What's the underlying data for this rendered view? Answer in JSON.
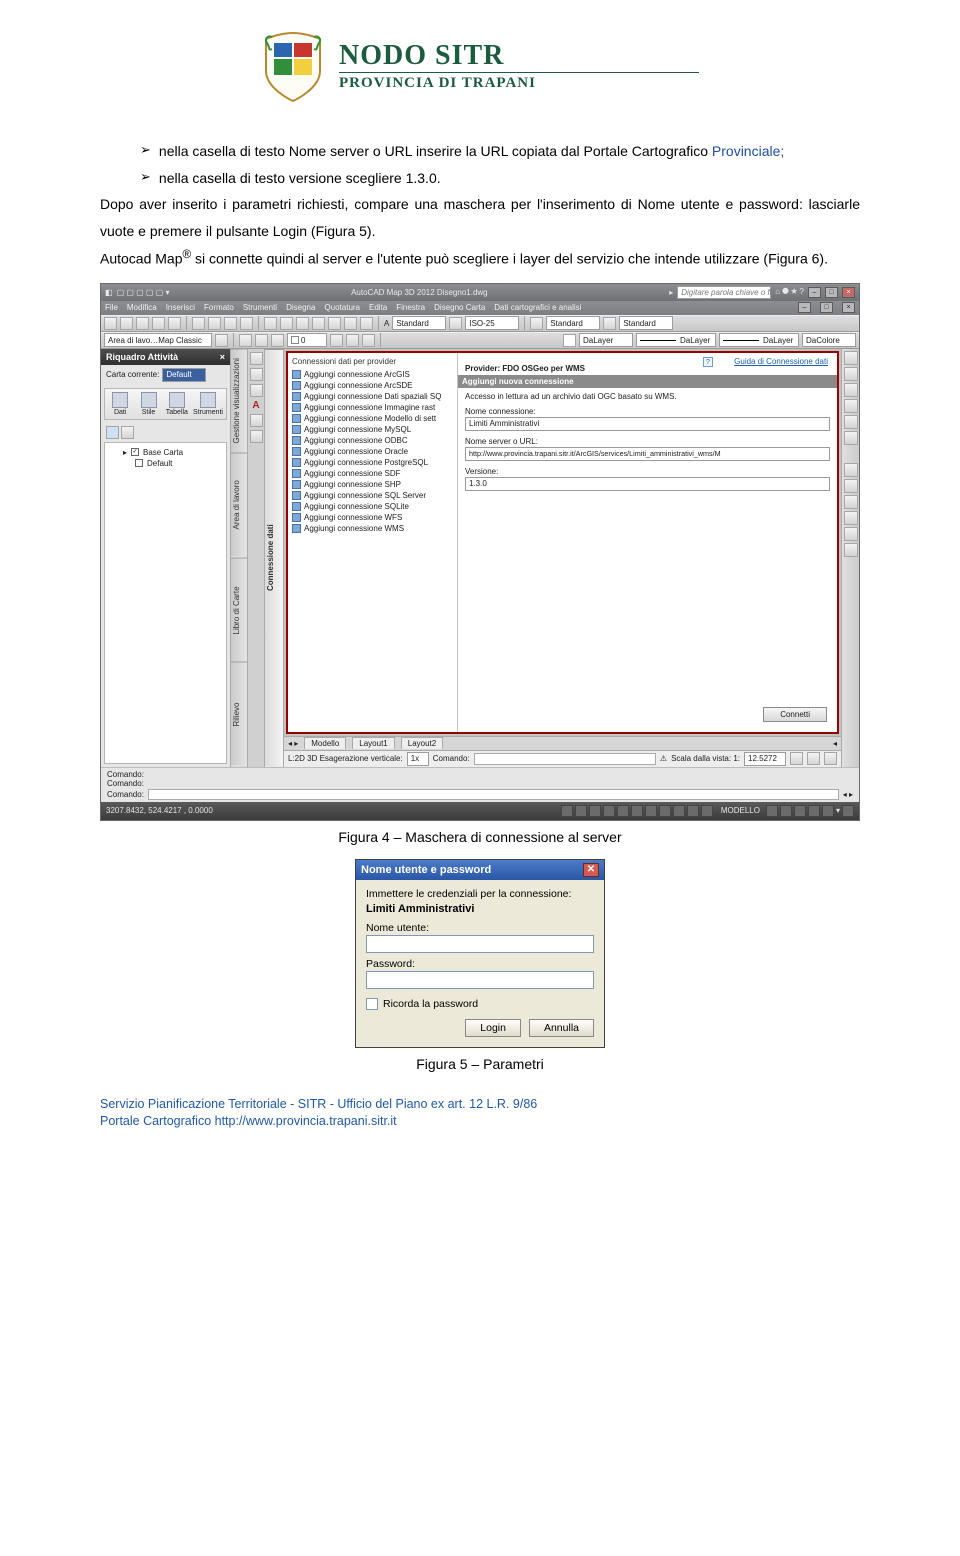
{
  "header": {
    "logo_main": "NODO SITR",
    "logo_sub": "PROVINCIA DI TRAPANI"
  },
  "body": {
    "bullet1_a": "nella casella di testo Nome server o URL inserire la URL copiata dal Portale Cartografico ",
    "bullet1_b": "Provinciale;",
    "bullet2": "nella casella di testo versione scegliere 1.3.0.",
    "para1": "Dopo aver inserito i parametri richiesti, compare una maschera per l'inserimento di Nome utente e password: lasciarle vuote e premere il pulsante Login (Figura 5).",
    "para2_a": "Autocad Map",
    "para2_sup": "®",
    "para2_b": " si connette quindi al server e l'utente può scegliere i layer del servizio che intende utilizzare (Figura 6)."
  },
  "screenshot": {
    "titlebar_title": "AutoCAD Map 3D 2012   Disegno1.dwg",
    "search_placeholder": "Digitare parola chiave o frase",
    "menus": [
      "File",
      "Modifica",
      "Inserisci",
      "Formato",
      "Strumenti",
      "Disegna",
      "Quotatura",
      "Edita",
      "Finestra",
      "Disegno Carta",
      "Dati cartografici e analisi"
    ],
    "tb2_area": "Area di lavo…Map Classic",
    "tb2_layer0": "0",
    "tb2_dalayer": "DaLayer",
    "tb2_dalayer2": "DaLayer",
    "tb2_dacolore": "DaColore",
    "tb1_standard": "Standard",
    "tb1_iso": "ISO-25",
    "tb1_standard2": "Standard",
    "tb1_standard3": "Standard",
    "left_panel_title": "Riquadro Attività",
    "left_panel_carta": "Carta corrente:",
    "left_panel_default": "Default",
    "left_tabs": [
      "Dati",
      "Stile",
      "Tabella",
      "Strumenti"
    ],
    "tree_basecarta": "Base Carta",
    "tree_default": "Default",
    "vtabs": [
      "Gestione visualizzazioni",
      "Area di lavoro",
      "Libro di Carte",
      "Rilievo",
      "Connessione dati"
    ],
    "conn_header": "Connessioni dati per provider",
    "conn_items": [
      "Aggiungi connessione ArcGIS",
      "Aggiungi connessione ArcSDE",
      "Aggiungi connessione Dati spaziali SQ",
      "Aggiungi connessione Immagine rast",
      "Aggiungi connessione Modello di sett",
      "Aggiungi connessione MySQL",
      "Aggiungi connessione ODBC",
      "Aggiungi connessione Oracle",
      "Aggiungi connessione PostgreSQL",
      "Aggiungi connessione SDF",
      "Aggiungi connessione SHP",
      "Aggiungi connessione SQL Server",
      "Aggiungi connessione SQLite",
      "Aggiungi connessione WFS",
      "Aggiungi connessione WMS"
    ],
    "help_link": "Guida di Connessione dati",
    "prov_title": "Provider: FDO OSGeo per WMS",
    "grey_title": "Aggiungi nuova connessione",
    "grey_desc": "Accesso in lettura ad un archivio dati OGC basato su WMS.",
    "lbl_nome_conn": "Nome connessione:",
    "val_nome_conn": "Limiti Amministrativi",
    "lbl_nome_url": "Nome server o URL:",
    "val_nome_url": "http://www.provincia.trapani.sitr.it/ArcGIS/services/Limiti_amministrativi_wms/M",
    "lbl_versione": "Versione:",
    "val_versione": "1.3.0",
    "btn_connetti": "Connetti",
    "model_tabs": [
      "Modello",
      "Layout1",
      "Layout2"
    ],
    "cmd_bar_prefix": "L:2D  3D  Esagerazione verticale:",
    "cmd_bar_ese": "1x",
    "cmd_bar_cmd": "Comando:",
    "cmd_bar_scala": "Scala dalla vista: 1:",
    "cmd_bar_scalaval": "12.5272",
    "cmd_stack": "Comando:\nComando:\nComando:",
    "status_left": "3207.8432, 524.4217 , 0.0000",
    "status_modello": "MODELLO"
  },
  "caption4": "Figura 4 – Maschera di connessione al server",
  "login": {
    "title": "Nome utente e password",
    "msg": "Immettere le credenziali per la connessione:",
    "name": "Limiti Amministrativi",
    "lbl_user": "Nome utente:",
    "lbl_pass": "Password:",
    "remember": "Ricorda la password",
    "btn_login": "Login",
    "btn_cancel": "Annulla"
  },
  "caption5": "Figura 5 – Parametri",
  "footer": {
    "line1": "Servizio Pianificazione Territoriale - SITR - Ufficio del Piano ex art. 12 L.R. 9/86",
    "line2": "Portale Cartografico http://www.provincia.trapani.sitr.it"
  }
}
